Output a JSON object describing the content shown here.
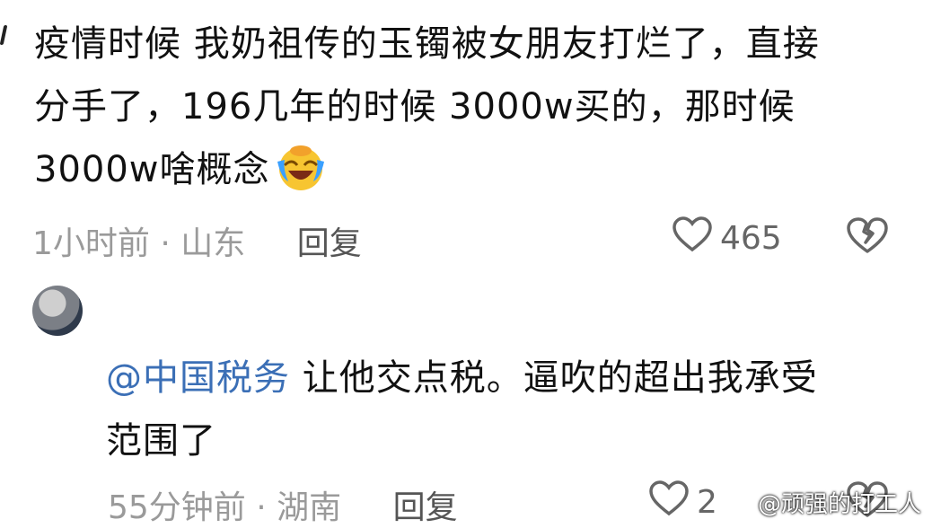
{
  "comment1": {
    "lines": [
      "疫情时候 我奶祖传的玉镯被女朋友打烂了，直接",
      "分手了，196几年的时候  3000w买的，那时候",
      "3000w啥概念"
    ],
    "emoji": "laughing-crying-emoji",
    "time_location": "1小时前 · 山东",
    "reply_label": "回复",
    "likes": "465"
  },
  "comment2": {
    "mention": "@中国税务",
    "line1_rest": " 让他交点税。逼吹的超出我承受",
    "line2": "范围了",
    "time_location": "55分钟前 · 湖南",
    "reply_label": "回复",
    "likes_partial": "2"
  },
  "watermark": "@顽强的打工人",
  "colors": {
    "link": "#3b6fb6",
    "meta": "#9a9a9a"
  }
}
